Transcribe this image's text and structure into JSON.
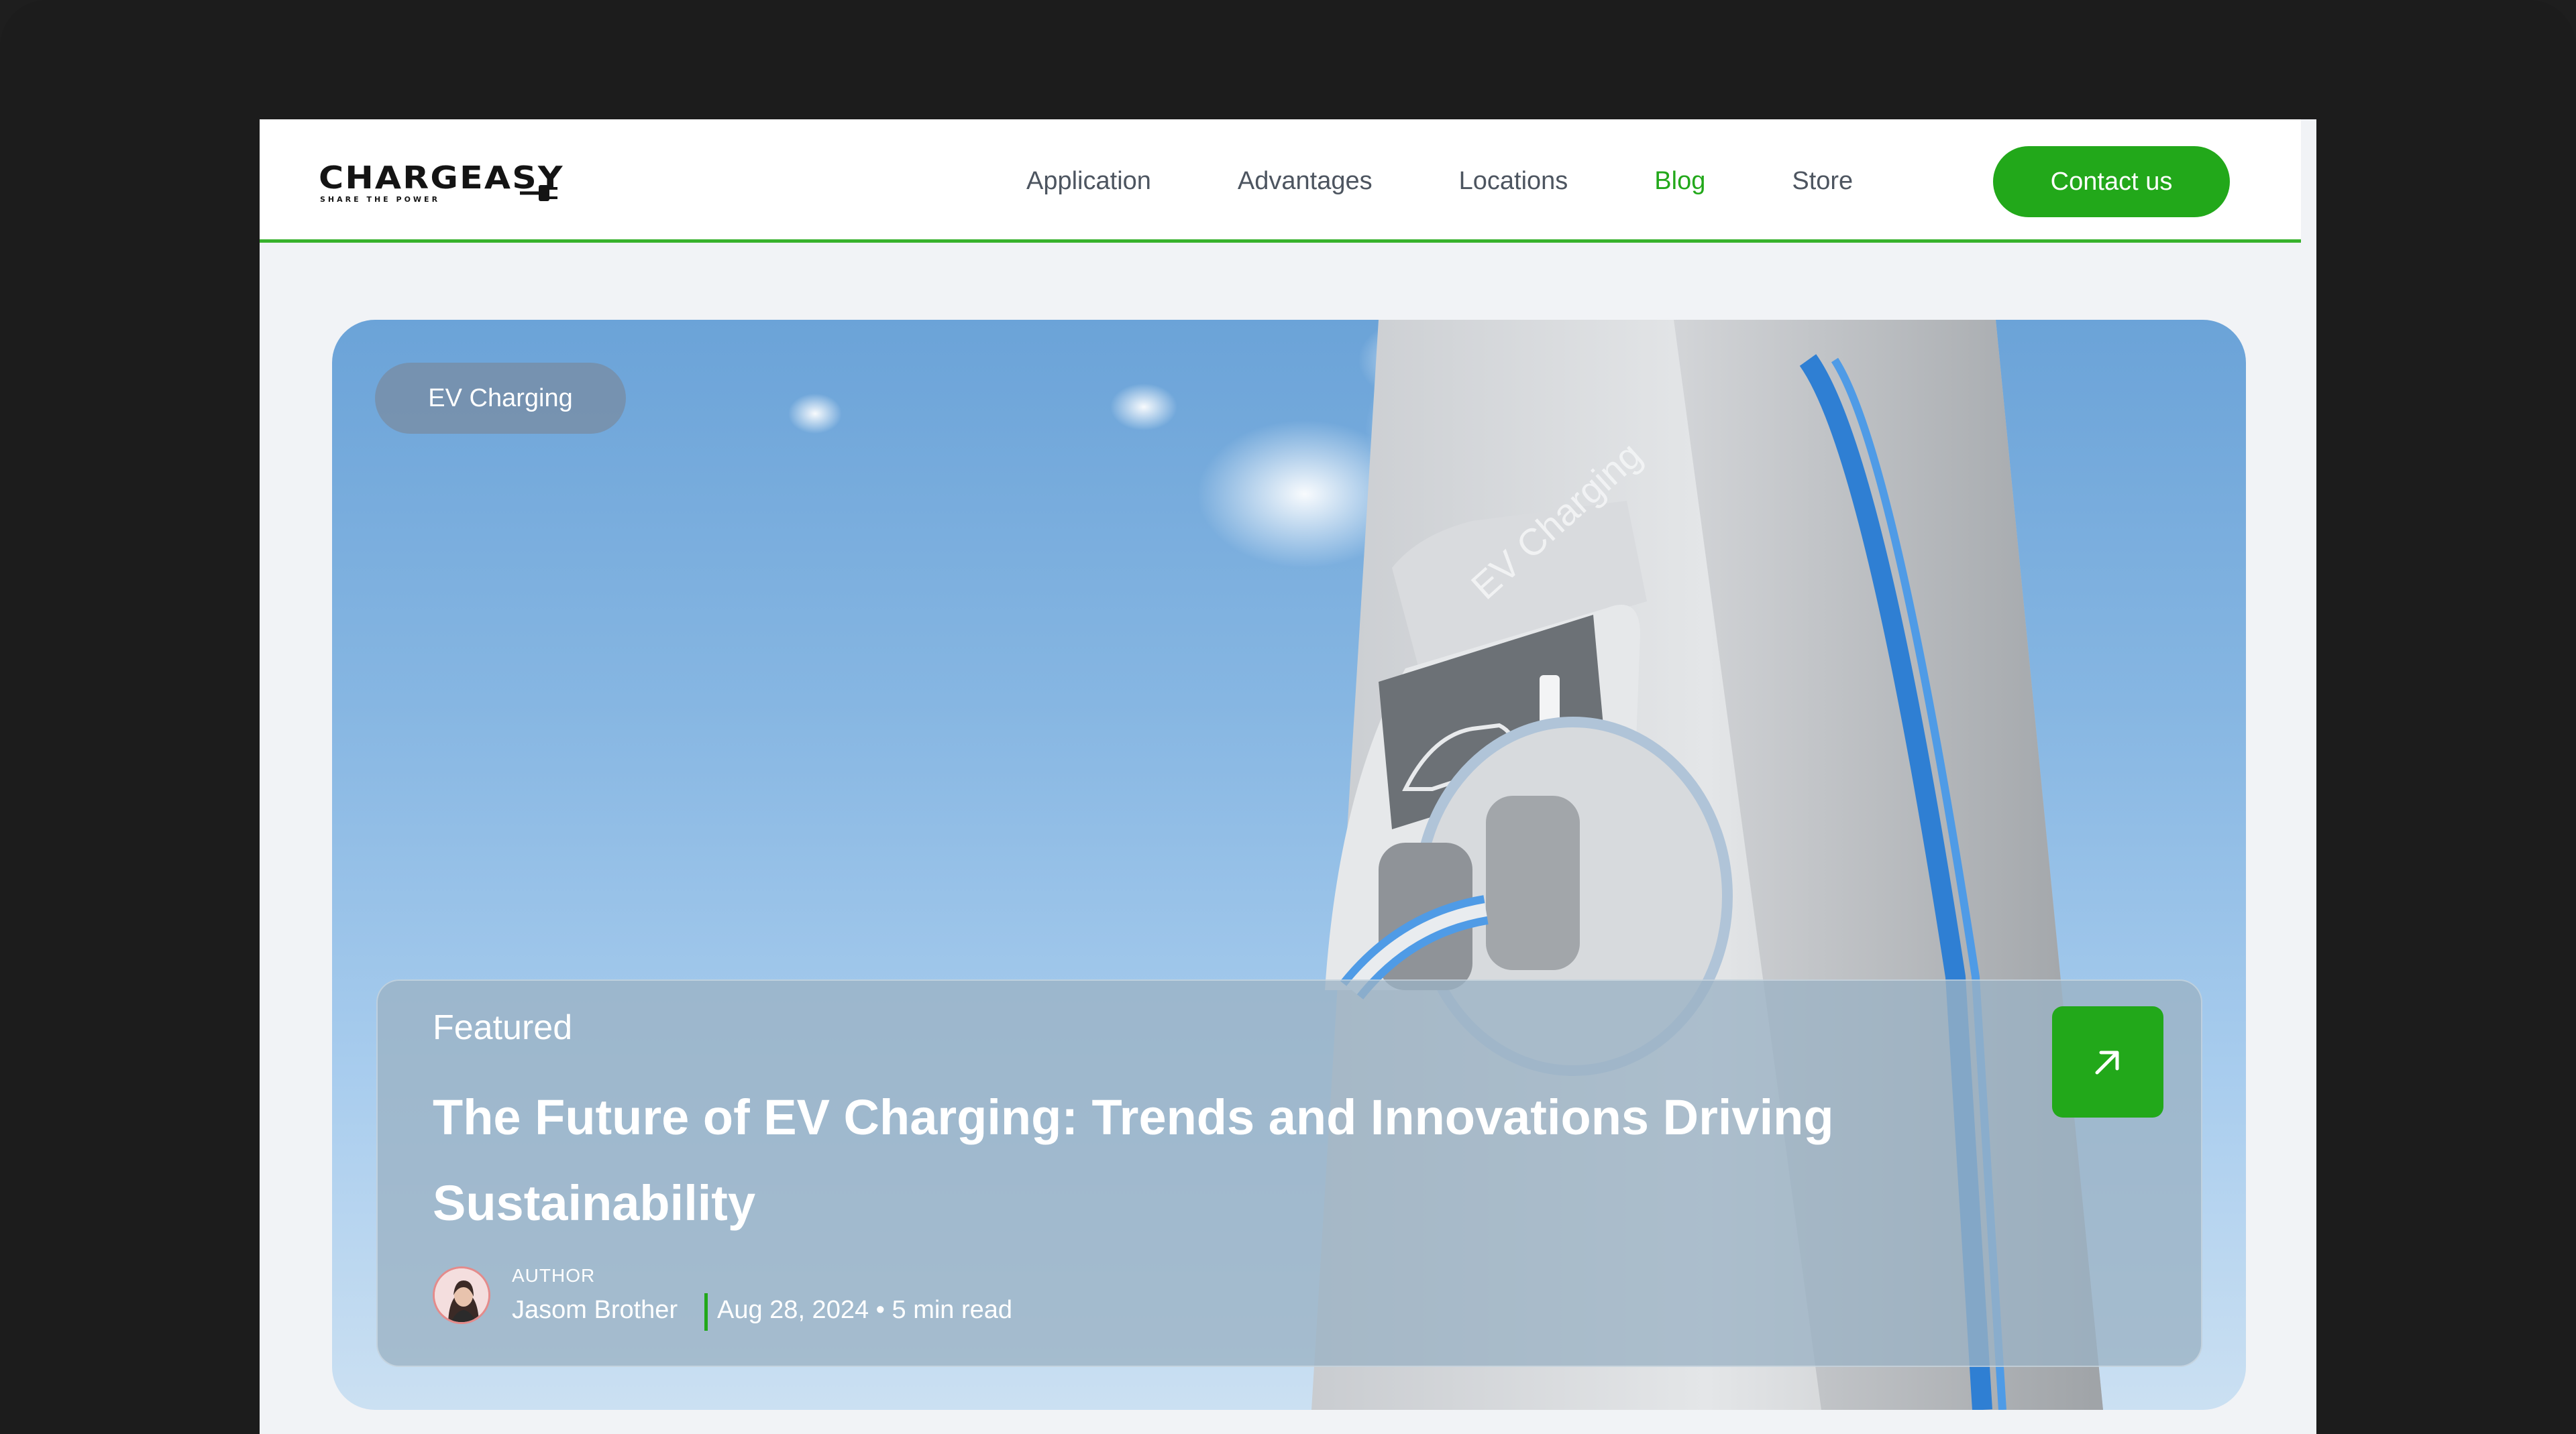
{
  "brand": {
    "name": "CHARGEASY",
    "tagline": "SHARE THE POWER"
  },
  "nav": {
    "items": [
      {
        "label": "Application",
        "active": false
      },
      {
        "label": "Advantages",
        "active": false
      },
      {
        "label": "Locations",
        "active": false
      },
      {
        "label": "Blog",
        "active": true
      },
      {
        "label": "Store",
        "active": false
      }
    ],
    "contact_label": "Contact us"
  },
  "hero": {
    "category_tag": "EV Charging",
    "station_label": "EV Charging",
    "featured_label": "Featured",
    "title": "The Future of EV Charging: Trends and Innovations Driving Sustainability",
    "author": {
      "label": "AUTHOR",
      "name": "Jasom Brother"
    },
    "date": "Aug 28, 2024",
    "read_time": "5 min read",
    "date_line": "Aug 28, 2024 • 5 min read",
    "arrow_icon": "arrow-up-right-icon"
  },
  "colors": {
    "accent": "#22a81a",
    "frame": "#1c1c1c",
    "page_bg": "#f1f3f6"
  }
}
